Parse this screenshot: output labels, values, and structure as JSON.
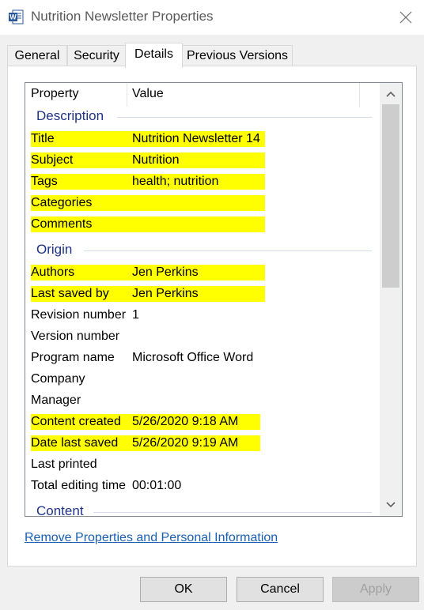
{
  "window": {
    "title": "Nutrition Newsletter Properties",
    "app_icon": "word-document-icon",
    "close_icon": "close-icon"
  },
  "tabs": [
    {
      "label": "General"
    },
    {
      "label": "Security"
    },
    {
      "label": "Details",
      "active": true
    },
    {
      "label": "Previous Versions"
    }
  ],
  "list": {
    "columns": {
      "property": "Property",
      "value": "Value"
    },
    "groups": {
      "description": "Description",
      "origin": "Origin",
      "content": "Content"
    },
    "rows": [
      {
        "property": "Title",
        "value": "Nutrition Newsletter 14",
        "highlighted": true
      },
      {
        "property": "Subject",
        "value": "Nutrition",
        "highlighted": true
      },
      {
        "property": "Tags",
        "value": "health; nutrition",
        "highlighted": true
      },
      {
        "property": "Categories",
        "value": "",
        "highlighted": true
      },
      {
        "property": "Comments",
        "value": "",
        "highlighted": true
      },
      {
        "property": "Authors",
        "value": "Jen Perkins",
        "highlighted": true
      },
      {
        "property": "Last saved by",
        "value": "Jen Perkins",
        "highlighted": true
      },
      {
        "property": "Revision number",
        "value": "1",
        "highlighted": false
      },
      {
        "property": "Version number",
        "value": "",
        "highlighted": false
      },
      {
        "property": "Program name",
        "value": "Microsoft Office Word",
        "highlighted": false
      },
      {
        "property": "Company",
        "value": "",
        "highlighted": false
      },
      {
        "property": "Manager",
        "value": "",
        "highlighted": false
      },
      {
        "property": "Content created",
        "value": "5/26/2020 9:18 AM",
        "highlighted": true
      },
      {
        "property": "Date last saved",
        "value": "5/26/2020 9:19 AM",
        "highlighted": true
      },
      {
        "property": "Last printed",
        "value": "",
        "highlighted": false
      },
      {
        "property": "Total editing time",
        "value": "00:01:00",
        "highlighted": false
      }
    ]
  },
  "link": "Remove Properties and Personal Information",
  "buttons": {
    "ok": "OK",
    "cancel": "Cancel",
    "apply": "Apply",
    "apply_enabled": false
  },
  "colors": {
    "highlight": "#ffff00",
    "group_header": "#1e3287",
    "link": "#1a5fb4"
  }
}
